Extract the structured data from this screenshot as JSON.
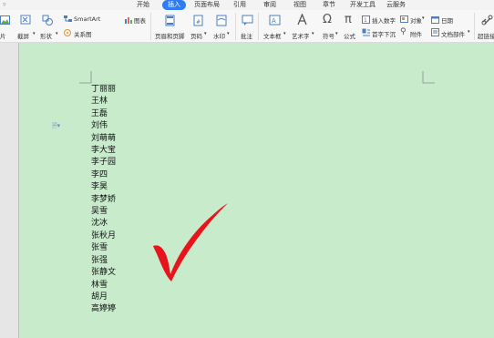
{
  "tabs": [
    {
      "label": "开始",
      "active": false
    },
    {
      "label": "插入",
      "active": true
    },
    {
      "label": "页面布局",
      "active": false
    },
    {
      "label": "引用",
      "active": false
    },
    {
      "label": "审阅",
      "active": false
    },
    {
      "label": "视图",
      "active": false
    },
    {
      "label": "章节",
      "active": false
    },
    {
      "label": "开发工具",
      "active": false
    },
    {
      "label": "云服务",
      "active": false
    }
  ],
  "ribbon": {
    "picture": "片",
    "screenshot": "截屏",
    "shapes": "形状",
    "smartart": "SmartArt",
    "chart": "图表",
    "relation": "关系图",
    "header_footer": "页眉和页脚",
    "page_number": "页码",
    "watermark": "水印",
    "comment": "批注",
    "textbox": "文本框",
    "wordart": "艺术字",
    "symbol": "符号",
    "formula": "公式",
    "insert_number": "插入数字",
    "object": "对象",
    "date": "日期",
    "drop_cap": "首字下沉",
    "attachment": "附件",
    "doc_parts": "文档部件",
    "hyperlink": "超链接"
  },
  "names": [
    "丁丽丽",
    "王林",
    "王磊",
    "刘伟",
    "刘萌萌",
    "李大宝",
    "李子园",
    "李四",
    "李昊",
    "李梦娇",
    "吴雪",
    "沈冰",
    "张秋月",
    "张雪",
    "张强",
    "张静文",
    "林雪",
    "胡月",
    "高婷婷"
  ],
  "colors": {
    "page_bg": "#c8ebcc",
    "accent": "#2d7cf6",
    "checkmark": "#e8141c"
  }
}
